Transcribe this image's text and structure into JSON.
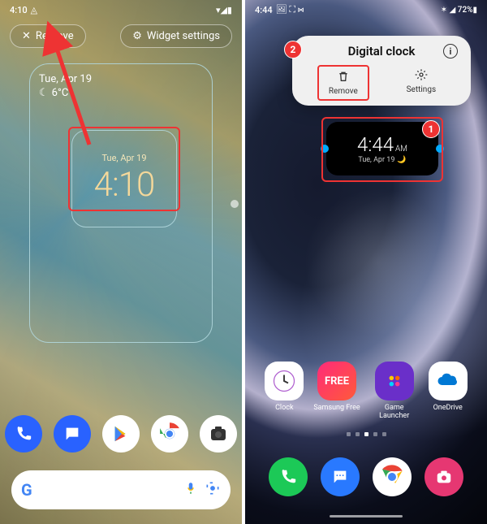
{
  "left": {
    "status": {
      "time": "4:10",
      "icons": "◬",
      "right_icons": "▾◢▮"
    },
    "actions": {
      "remove": "Remove",
      "settings": "Widget settings"
    },
    "widget": {
      "date_small": "Tue, Apr 19",
      "temp": "6°C",
      "clock_date": "Tue, Apr 19",
      "clock_time": "4:10"
    },
    "dock": [
      "phone",
      "messages",
      "play",
      "chrome",
      "camera"
    ]
  },
  "right": {
    "status": {
      "time": "4:44",
      "icons": "🖼 ⛶ ⋈",
      "right": "✶ ◢ 72%▮"
    },
    "popup": {
      "title": "Digital clock",
      "remove": "Remove",
      "settings": "Settings"
    },
    "widget": {
      "time": "4:44",
      "ampm": "AM",
      "date": "Tue, Apr 19"
    },
    "badges": {
      "one": "1",
      "two": "2"
    },
    "apps": [
      {
        "label": "Clock"
      },
      {
        "label": "Samsung Free",
        "text": "FREE"
      },
      {
        "label": "Game Launcher"
      },
      {
        "label": "OneDrive"
      }
    ]
  }
}
